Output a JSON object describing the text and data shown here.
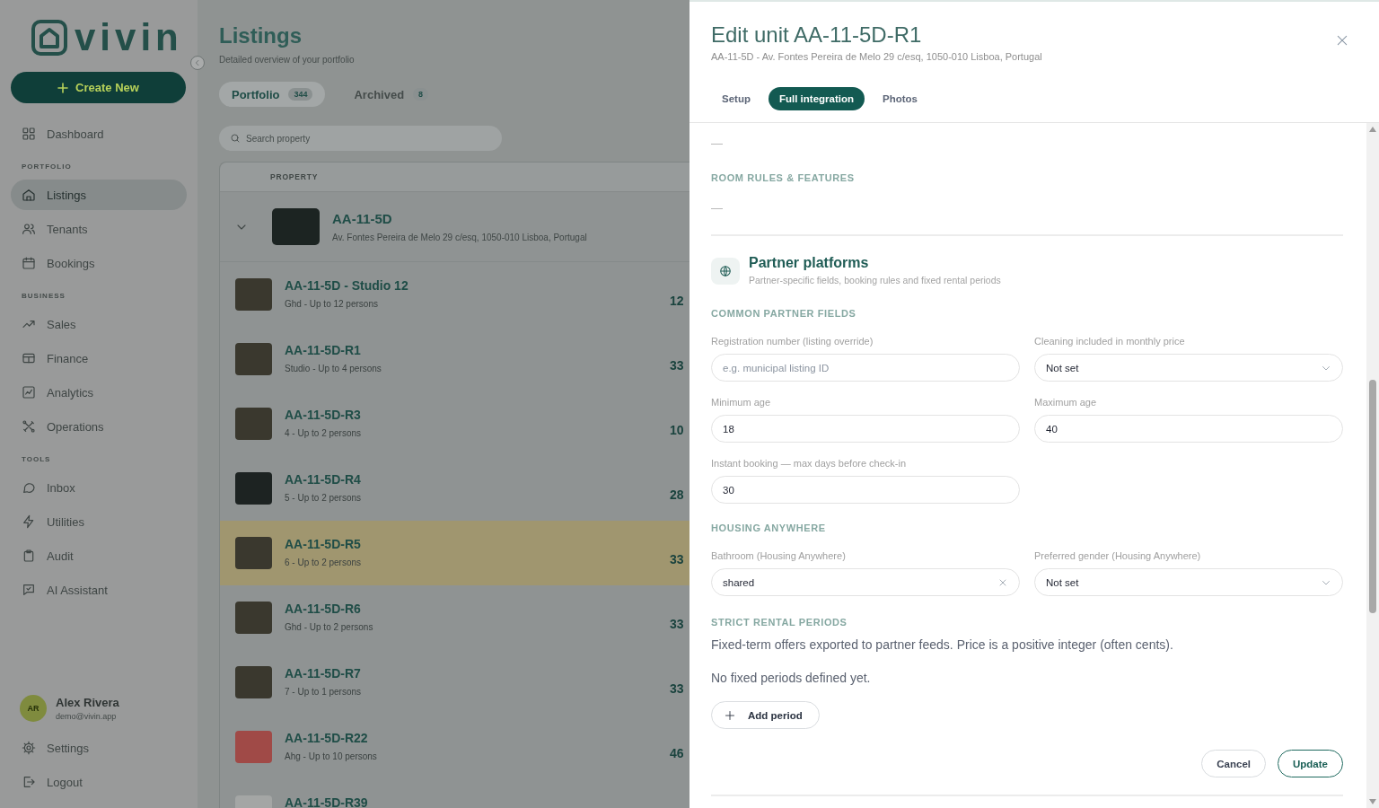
{
  "sidebar": {
    "logo": "vivin",
    "create_button": "Create New",
    "nav_top": [
      {
        "label": "Dashboard",
        "selected": false
      }
    ],
    "nav_sections": [
      {
        "heading": "PORTFOLIO",
        "items": [
          {
            "label": "Listings",
            "selected": true
          },
          {
            "label": "Tenants",
            "selected": false
          },
          {
            "label": "Bookings",
            "selected": false
          }
        ]
      },
      {
        "heading": "BUSINESS",
        "items": [
          {
            "label": "Sales",
            "selected": false
          },
          {
            "label": "Finance",
            "selected": false
          },
          {
            "label": "Analytics",
            "selected": false
          },
          {
            "label": "Operations",
            "selected": false
          }
        ]
      },
      {
        "heading": "TOOLS",
        "items": [
          {
            "label": "Inbox",
            "selected": false
          },
          {
            "label": "Utilities",
            "selected": false
          },
          {
            "label": "Audit",
            "selected": false
          },
          {
            "label": "AI Assistant",
            "selected": false
          }
        ]
      }
    ],
    "user": {
      "initials": "AR",
      "name": "Alex Rivera",
      "email": "demo@vivin.app"
    },
    "footer_items": [
      "Settings",
      "Logout"
    ]
  },
  "listings_page": {
    "title": "Listings",
    "subtitle": "Detailed overview of your portfolio",
    "tabs": [
      {
        "label": "Portfolio",
        "count": "344",
        "selected": true
      },
      {
        "label": "Archived",
        "count": "8",
        "selected": false
      }
    ],
    "search": {
      "placeholder": "Search property"
    },
    "table": {
      "columns": [
        "PROPERTY"
      ],
      "group": {
        "name": "AA-11-5D",
        "address": "Av. Fontes Pereira de Melo 29 c/esq, 1050-010 Lisboa, Portugal",
        "expanded": true
      },
      "rows": [
        {
          "name": "AA-11-5D - Studio 12",
          "details": "Ghd - Up to 12 persons",
          "column_2": "12",
          "color": "#3a382e",
          "selected": false
        },
        {
          "name": "AA-11-5D-R1",
          "details": "Studio - Up to 4 persons",
          "column_2": "33",
          "color": "#3a382e",
          "selected": false
        },
        {
          "name": "AA-11-5D-R3",
          "details": "4 - Up to 2 persons",
          "column_2": "10",
          "color": "#3a382e",
          "selected": false
        },
        {
          "name": "AA-11-5D-R4",
          "details": "5 - Up to 2 persons",
          "column_2": "28",
          "color": "#1d2322",
          "selected": false
        },
        {
          "name": "AA-11-5D-R5",
          "details": "6 - Up to 2 persons",
          "column_2": "33",
          "color": "#3a382e",
          "selected": true
        },
        {
          "name": "AA-11-5D-R6",
          "details": "Ghd - Up to 2 persons",
          "column_2": "33",
          "color": "#3a382e",
          "selected": false
        },
        {
          "name": "AA-11-5D-R7",
          "details": "7 - Up to 1 persons",
          "column_2": "33",
          "color": "#3a382e",
          "selected": false
        },
        {
          "name": "AA-11-5D-R22",
          "details": "Ahg - Up to 10 persons",
          "column_2": "46",
          "color": "#a04a47",
          "selected": false
        },
        {
          "name": "AA-11-5D-R39",
          "color": "#a4a6a5",
          "selected": false
        }
      ]
    }
  },
  "drawer": {
    "title": "Edit unit AA-11-5D-R1",
    "subtitle": "AA-11-5D - Av. Fontes Pereira de Melo 29 c/esq, 1050-010 Lisboa, Portugal",
    "tabs": [
      {
        "label": "Setup",
        "selected": false
      },
      {
        "label": "Full integration",
        "selected": true
      },
      {
        "label": "Photos",
        "selected": false
      }
    ],
    "first_value": "—",
    "room_rules": {
      "heading": "ROOM RULES & FEATURES",
      "value": "—"
    },
    "partner_platforms": {
      "title": "Partner platforms",
      "subtitle": "Partner-specific fields, booking rules and fixed rental periods",
      "groups": [
        {
          "heading": "COMMON PARTNER FIELDS",
          "fields": [
            {
              "kind": "text",
              "label": "Registration number (listing override)",
              "placeholder": "e.g. municipal listing ID"
            },
            {
              "kind": "select",
              "label": "Cleaning included in monthly price",
              "value": "Not set"
            },
            {
              "kind": "text",
              "label": "Minimum age",
              "value": "18"
            },
            {
              "kind": "text",
              "label": "Maximum age",
              "value": "40"
            },
            {
              "kind": "text",
              "label": "Instant booking — max days before check-in",
              "value": "30"
            }
          ]
        },
        {
          "heading": "HOUSING ANYWHERE",
          "fields": [
            {
              "kind": "combobox",
              "label": "Bathroom (Housing Anywhere)",
              "value": "shared"
            },
            {
              "kind": "select",
              "label": "Preferred gender (Housing Anywhere)",
              "value": "Not set"
            }
          ]
        }
      ],
      "strict_rental_periods": {
        "heading": "STRICT RENTAL PERIODS",
        "description": "Fixed-term offers exported to partner feeds. Price is a positive integer (often cents).",
        "empty_message": "No fixed periods defined yet.",
        "add_button": "Add period"
      }
    },
    "buttons": [
      {
        "kind": "secondary",
        "label": "Cancel"
      },
      {
        "kind": "primary",
        "label": "Update"
      }
    ]
  }
}
